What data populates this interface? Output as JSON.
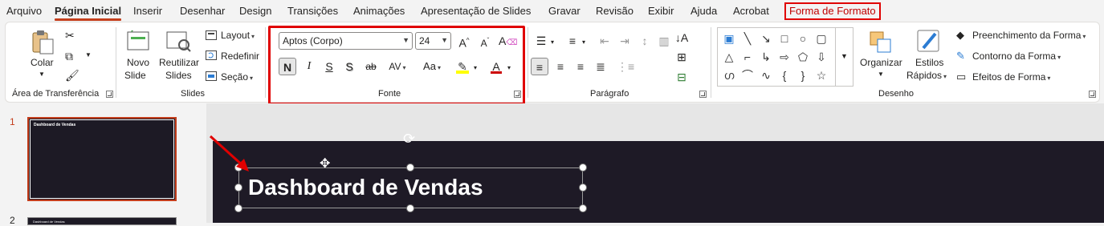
{
  "tabs": [
    "Arquivo",
    "Página Inicial",
    "Inserir",
    "Desenhar",
    "Design",
    "Transições",
    "Animações",
    "Apresentação de Slides",
    "Gravar",
    "Revisão",
    "Exibir",
    "Ajuda",
    "Acrobat",
    "Forma de Formato"
  ],
  "groups": {
    "clipboard": {
      "label": "Área de Transferência",
      "paste": "Colar"
    },
    "slides": {
      "label": "Slides",
      "new_slide_1": "Novo",
      "new_slide_2": "Slide",
      "reuse_1": "Reutilizar",
      "reuse_2": "Slides",
      "layout": "Layout",
      "reset": "Redefinir",
      "section": "Seção"
    },
    "font": {
      "label": "Fonte",
      "font_name": "Aptos (Corpo)",
      "font_size": "24",
      "bold": "N",
      "italic": "I",
      "underline": "S",
      "shadow": "S",
      "strike": "ab",
      "spacing": "AV",
      "case": "Aa"
    },
    "paragraph": {
      "label": "Parágrafo"
    },
    "drawing": {
      "label": "Desenho",
      "arrange": "Organizar",
      "styles_1": "Estilos",
      "styles_2": "Rápidos",
      "fill": "Preenchimento da Forma",
      "outline": "Contorno da Forma",
      "effects": "Efeitos de Forma"
    }
  },
  "slides": {
    "s1_number": "1",
    "s1_title": "Dashboard de Vendas",
    "s2_number": "2",
    "s2_title": "Dashboard de Vendas"
  },
  "slide": {
    "title": "Dashboard de Vendas"
  },
  "colors": {
    "accent": "#c43e1c",
    "highlight": "#e00000",
    "slide_bg": "#1e1a26"
  }
}
